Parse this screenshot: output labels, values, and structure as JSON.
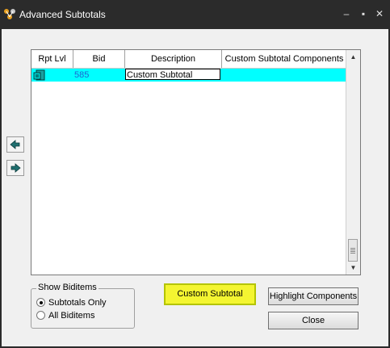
{
  "window": {
    "title": "Advanced Subtotals",
    "icon": "app-logo-icon"
  },
  "grid": {
    "columns": [
      "Rpt Lvl",
      "Bid",
      "Description",
      "Custom Subtotal Components"
    ],
    "rows": [
      {
        "rpt_lvl_icon": "subtotal-level-icon",
        "bid": "585",
        "description": "Custom Subtotal",
        "components": ""
      }
    ]
  },
  "show_biditems": {
    "legend": "Show Biditems",
    "options": [
      "Subtotals Only",
      "All Biditems"
    ],
    "selected": "Subtotals Only"
  },
  "buttons": {
    "custom_subtotal": "Custom Subtotal",
    "highlight_components": "Highlight Components",
    "close": "Close"
  },
  "colors": {
    "row_highlight": "#00ffff",
    "button_highlight": "#f4f531",
    "bid_text": "#1e64d0"
  }
}
